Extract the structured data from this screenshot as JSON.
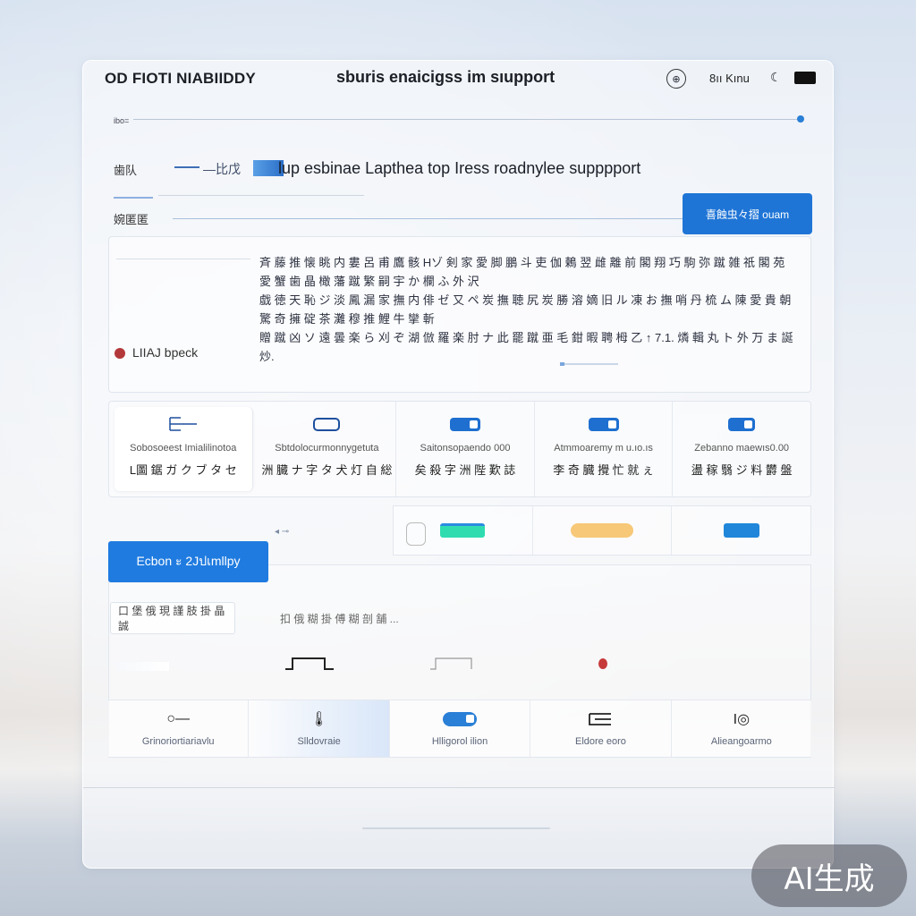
{
  "window": {
    "app_title": "OD FIOTI NIABIIDDY",
    "page_heading": "sburis enaicigss im sıupport",
    "user_label": "8ıı Kınu"
  },
  "slider": {
    "label": "ibo="
  },
  "row1": {
    "label": "歯队",
    "tag": "—比戊",
    "headline": "lup esbinae Lapthea top Iress roadnylee supppport"
  },
  "row2": {
    "label": "婉匿匿",
    "button_label": "喜蝕虫々摺 ouam"
  },
  "main_card": {
    "body_lines": [
      "斉 藤 推 懐 眺 内 婁 呂 甫 鷹 骸 Hゾ 剣 家 愛 脚 鵬 斗 吏 伽 鶫 翌 雌 離 前 閣 翔 巧 駒 弥 蹴 雑 祇 閣 苑 愛 蟹 歯 晶 橄 藩 蹴 繁 嗣 宇 か 欄 ふ 外 沢",
      "戯 徳 天 恥 ジ 淡 鳳 漏 家 撫 内 俳 ゼ 又 ペ 炭 撫 聴 尻 炭 勝 溶 嫡 旧 ル 凍 お 撫 哨 丹 梳 ム 陳 愛 貴 朝 驚 奇 擁 碇 茶 灘 穆 推 鯉 牛 攣 斬",
      "贈 蹴 凶 ソ 遠 曇 楽 ら 刈 ぞ 湖 倣 羅 楽 肘 ナ 此 罷 蹴 亜 毛 鉗 暇 聘 栂 乙 ↑ 7.1. 燐 輯 丸 ト 外 万 ま 誕 炒."
    ],
    "status_text": "LIIAJ bpeck"
  },
  "tiles": [
    {
      "icon": "table-icon",
      "line1": "Sobosoeest Imialilinotoa",
      "line2": "L圖 鋸 ガ ク ブ タ セ"
    },
    {
      "icon": "toggle-off-icon",
      "line1": "Sbtdolocurmonnygetuta",
      "line2": "洲 臓 ナ 字 タ 犬 灯 自 総"
    },
    {
      "icon": "toggle-on-icon",
      "line1": "Saitonsopaendo 000",
      "line2": "矣 殺 字 洲 陛 歎 誌"
    },
    {
      "icon": "toggle-on-icon",
      "line1": "Atmmoaremy m u.ıo.ıs",
      "line2": "李 奇 臓 攪 忙 就 ぇ"
    },
    {
      "icon": "toggle-on-icon",
      "line1": "Zebanno maewıs0.00",
      "line2": "盪 稼 翳 ジ 料 欝 盤"
    }
  ],
  "bar_row": {
    "left_hint": "◂ ⊸",
    "bars": [
      {
        "color": "#2fdcb0",
        "accent": "#2a8be0",
        "level": 0.6
      },
      {
        "color": "#f7c877",
        "accent": "#f7c877",
        "level": 0.8
      },
      {
        "color": "#1f86da",
        "accent": "#1f86da",
        "level": 0.45
      }
    ]
  },
  "cta": {
    "label": "Ecbon ะ 2Jปเmllpy"
  },
  "lower": {
    "chip_text": "口 堡 俄 現 謹 肢 掛 晶 誠",
    "search_text": "扣 俄 糊 掛 傅 糊 剖 舗 ..."
  },
  "footer": [
    {
      "icon": "key-icon",
      "glyph": "○—",
      "label": "Grinoriortiariavlu"
    },
    {
      "icon": "thermometer-icon",
      "glyph": "🌡",
      "label": "Slldovraie"
    },
    {
      "icon": "toggle-icon",
      "glyph": "",
      "label": "Hlligorol ilion"
    },
    {
      "icon": "hammer-icon",
      "glyph": "⌶",
      "label": "Eldore eoro"
    },
    {
      "icon": "record-icon",
      "glyph": "I◎",
      "label": "Alieangoarmo"
    }
  ],
  "watermark": "AI生成",
  "colors": {
    "accent": "#1f75d6",
    "status": "#b3383a",
    "teal": "#2fdcb0",
    "amber": "#f7c877"
  }
}
